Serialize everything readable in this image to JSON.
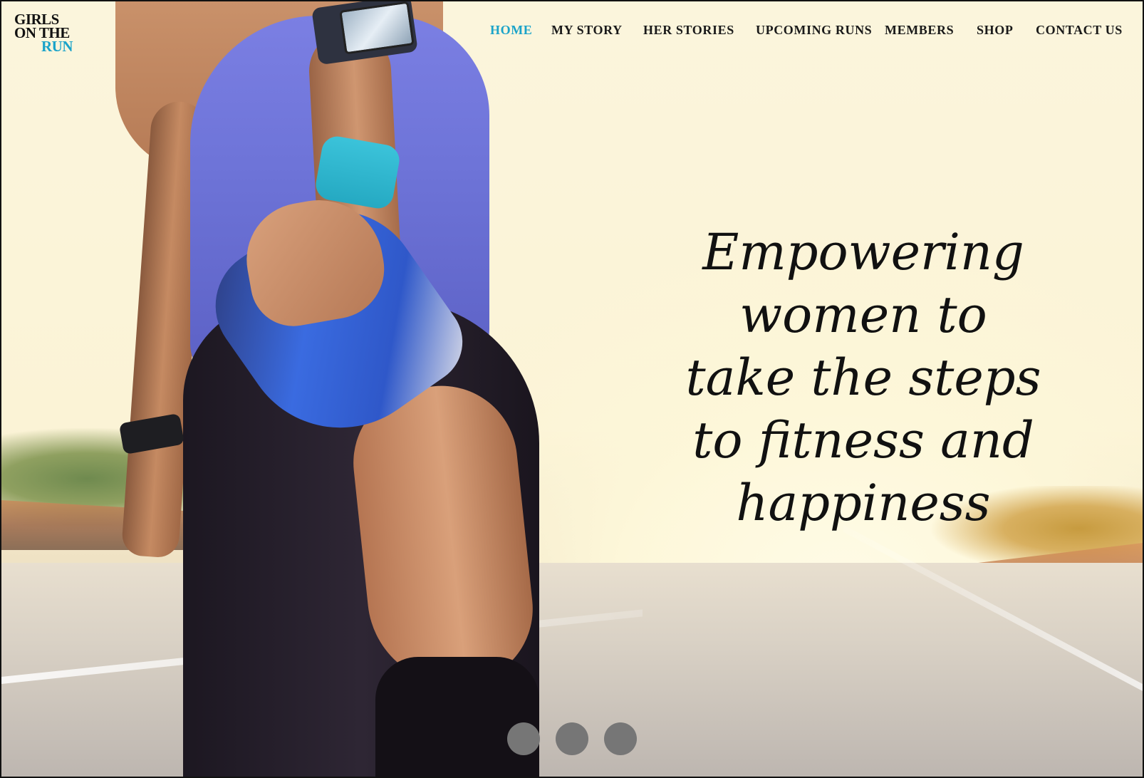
{
  "logo": {
    "line1": "GIRLS",
    "line2": "ON THE",
    "line3": "RUN",
    "accent_color": "#1aa3c9"
  },
  "nav": {
    "items": [
      {
        "label": "HOME",
        "active": true
      },
      {
        "label": "MY STORY",
        "active": false
      },
      {
        "label": "HER STORIES",
        "active": false
      },
      {
        "label": "UPCOMING RUNS",
        "active": false
      },
      {
        "label": "MEMBERS",
        "active": false
      },
      {
        "label": "SHOP",
        "active": false
      },
      {
        "label": "CONTACT US",
        "active": false
      }
    ]
  },
  "hero": {
    "lines": [
      "Empowering",
      "women to",
      "take the steps",
      "to fitness and",
      "happiness"
    ]
  },
  "slider": {
    "slide_count": 3,
    "dot_color": "#767676"
  },
  "hero_image": {
    "description_icon": "runner-stretching-photo"
  }
}
